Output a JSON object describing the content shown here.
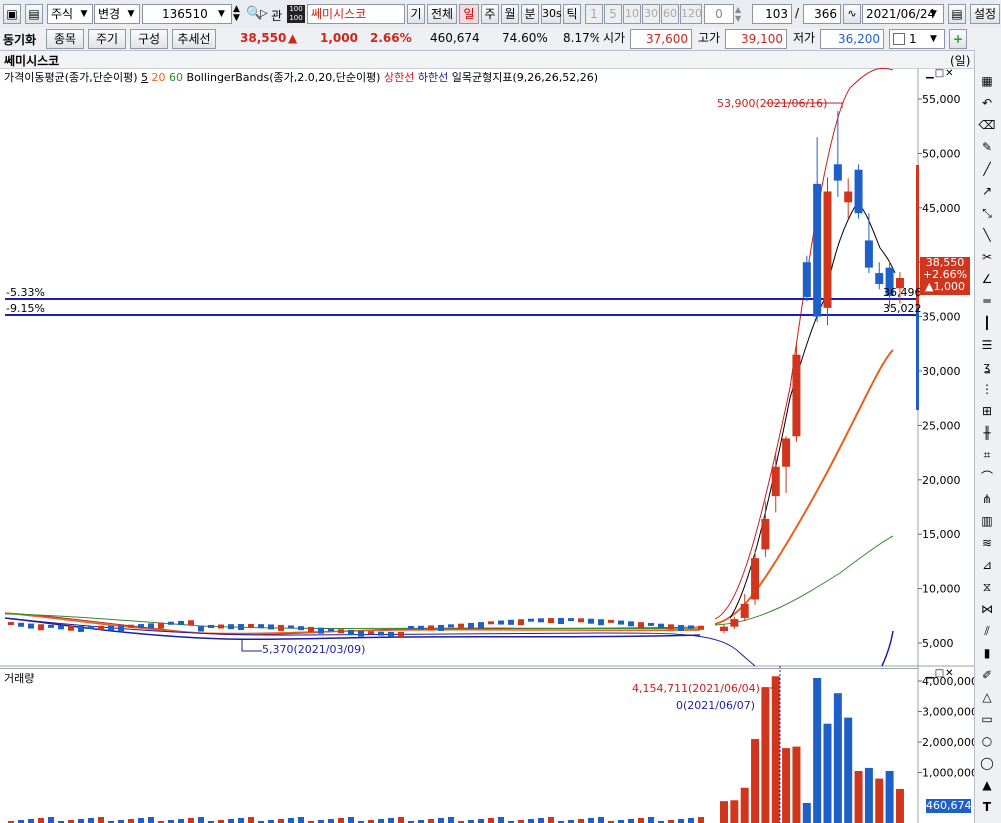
{
  "toolbar1": {
    "market": "주식",
    "change": "변경",
    "code": "136510",
    "related": "관",
    "name": "쎄미시스코",
    "period_buttons": [
      "기",
      "전체",
      "일",
      "주",
      "월",
      "분",
      "30s",
      "틱"
    ],
    "num_buttons": [
      "1",
      "5",
      "10",
      "30",
      "60",
      "120"
    ],
    "zero": "0",
    "count": "103",
    "slash": "/",
    "total": "366",
    "date": "2021/06/24",
    "settings": "설정"
  },
  "toolbar2": {
    "title": "동기화",
    "buttons": [
      "종목",
      "주기",
      "구성",
      "추세선"
    ],
    "price": "38,550",
    "arrow": "▲",
    "change": "1,000",
    "rate": "2.66%",
    "volume": "460,674",
    "ratio1": "74.60%",
    "ratio2": "8.17%",
    "open_label": "시가",
    "open": "37,600",
    "high_label": "고가",
    "high": "39,100",
    "low_label": "저가",
    "low": "36,200",
    "select_value": "1"
  },
  "chart_title": "쎄미시스코",
  "period_label": "(일)",
  "legend": {
    "ma": "가격이동평균(종가,단순이평)",
    "ma_periods": [
      "5",
      "20",
      "60"
    ],
    "bb": "BollingerBands(종가,2.0,20,단순이평)",
    "upper": "상한선",
    "lower": "하한선",
    "ichimoku": "일목균형지표(9,26,26,52,26)"
  },
  "annotations": {
    "high": "53,900(2021/06/16)",
    "low": "5,370(2021/03/09)",
    "line1_pct": "-5.33%",
    "line1_val": "36,496",
    "line2_pct": "-9.15%",
    "line2_val": "35,022",
    "price_box": [
      "38,550",
      "+2.66%",
      "▲1,000"
    ],
    "vol_high": "4,154,711(2021/06/04)",
    "vol_low": "0(2021/06/07)",
    "vol_current": "460,674"
  },
  "volume_title": "거래량",
  "colors": {
    "up": "#d0361d",
    "down": "#1f5fc8",
    "line_blue": "#1e1ea0",
    "ma20": "#e8601c",
    "ma60": "#2f8a2f",
    "bb": "#c81e1e"
  },
  "chart_data": [
    {
      "type": "line",
      "title": "쎄미시스코",
      "series": [
        {
          "name": "5",
          "values": []
        },
        {
          "name": "20",
          "values": []
        },
        {
          "name": "60",
          "values": []
        }
      ],
      "y_ticks": [
        "55,000",
        "50,000",
        "45,000",
        "40,000",
        "35,000",
        "30,000",
        "25,000",
        "20,000",
        "15,000",
        "10,000",
        "5,000"
      ],
      "ylim": [
        2000,
        57000
      ],
      "candles": [
        {
          "o": 6100,
          "h": 6700,
          "l": 5900,
          "c": 6500
        },
        {
          "o": 6500,
          "h": 7400,
          "l": 6300,
          "c": 7200
        },
        {
          "o": 7300,
          "h": 9500,
          "l": 7000,
          "c": 8600
        },
        {
          "o": 9000,
          "h": 13500,
          "l": 8500,
          "c": 12800
        },
        {
          "o": 13600,
          "h": 18000,
          "l": 12900,
          "c": 16400
        },
        {
          "o": 18500,
          "h": 22500,
          "l": 17000,
          "c": 21200
        },
        {
          "o": 21200,
          "h": 24000,
          "l": 18800,
          "c": 23800
        },
        {
          "o": 24000,
          "h": 32500,
          "l": 23500,
          "c": 31500
        },
        {
          "o": 40000,
          "h": 40600,
          "l": 36400,
          "c": 36800
        },
        {
          "o": 47200,
          "h": 51500,
          "l": 34500,
          "c": 35000
        },
        {
          "o": 35800,
          "h": 47800,
          "l": 34200,
          "c": 46500
        },
        {
          "o": 49000,
          "h": 53900,
          "l": 46000,
          "c": 47500
        },
        {
          "o": 45500,
          "h": 47700,
          "l": 44000,
          "c": 46500
        },
        {
          "o": 48500,
          "h": 49000,
          "l": 44000,
          "c": 44500
        },
        {
          "o": 42000,
          "h": 44500,
          "l": 39000,
          "c": 39500
        },
        {
          "o": 39000,
          "h": 40000,
          "l": 37500,
          "c": 38000
        },
        {
          "o": 39500,
          "h": 40000,
          "l": 35800,
          "c": 36900
        },
        {
          "o": 37600,
          "h": 39100,
          "l": 36200,
          "c": 38550
        }
      ]
    },
    {
      "type": "bar",
      "title": "거래량",
      "y_ticks": [
        "4,000,000",
        "3,000,000",
        "2,000,000",
        "1,000,000"
      ],
      "ylim": [
        0,
        4500000
      ],
      "values": [
        60000,
        90000,
        500000,
        2100000,
        3800000,
        4154711,
        1800000,
        1850000,
        0,
        4100000,
        2600000,
        3600000,
        2800000,
        1050000,
        1150000,
        800000,
        1050000,
        460674
      ],
      "colors": [
        "up",
        "up",
        "up",
        "up",
        "up",
        "up",
        "up",
        "up",
        "down",
        "down",
        "down",
        "down",
        "down",
        "up",
        "down",
        "up",
        "down",
        "up"
      ]
    }
  ]
}
